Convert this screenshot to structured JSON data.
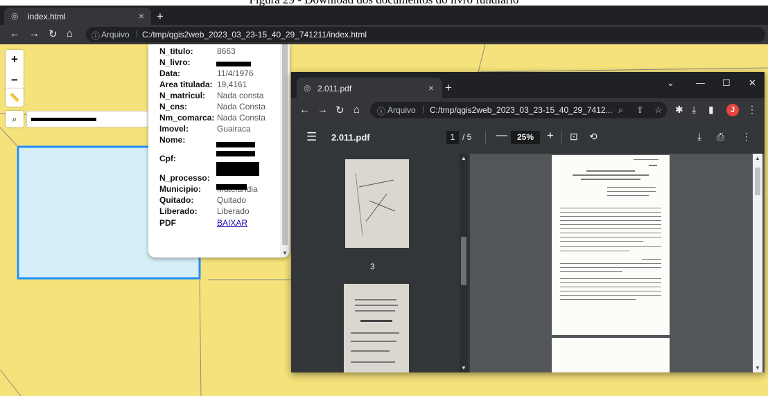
{
  "caption": "Figura 29 - Download dos documentos do livro fundiário",
  "main_browser": {
    "tab_title": "index.html",
    "address_label": "Arquivo",
    "url": "C:/tmp/qgis2web_2023_03_23-15_40_29_741211/index.html"
  },
  "map": {
    "zoom_in": "+",
    "zoom_out": "−",
    "colors": {
      "parcel_fill": "#f5e27a",
      "selected_fill": "#d6eef8",
      "selected_stroke": "#1e90ff"
    }
  },
  "popup": {
    "rows": [
      {
        "key": "N_titulo:",
        "value": "8663"
      },
      {
        "key": "N_livro:",
        "value": ""
      },
      {
        "key": "Data:",
        "value": "11/4/1976"
      },
      {
        "key": "Area titulada:",
        "value": "19,4161"
      },
      {
        "key": "N_matricul:",
        "value": "Nada consta"
      },
      {
        "key": "N_cns:",
        "value": "Nada Consta"
      },
      {
        "key": "Nm_comarca:",
        "value": "Nada Consta"
      },
      {
        "key": "Imovel:",
        "value": "Guairaca"
      },
      {
        "key": "Nome:",
        "value": ""
      },
      {
        "key": "Cpf:",
        "value": ""
      },
      {
        "key": "N_processo:",
        "value": ""
      },
      {
        "key": "Municipio:",
        "value": "Matelandia"
      },
      {
        "key": "Quitado:",
        "value": "Quitado"
      },
      {
        "key": "Liberado:",
        "value": "Liberado"
      },
      {
        "key": "PDF",
        "value": "BAIXAR"
      }
    ]
  },
  "pdf_window": {
    "tab_title": "2.011.pdf",
    "address_label": "Arquivo",
    "url": "C:/tmp/qgis2web_2023_03_23-15_40_29_7412...",
    "avatar_letter": "J",
    "viewer": {
      "file_name": "2.011.pdf",
      "current_page": "1",
      "total_pages": "/ 5",
      "zoom": "25%",
      "thumbnail_label": "3"
    }
  }
}
